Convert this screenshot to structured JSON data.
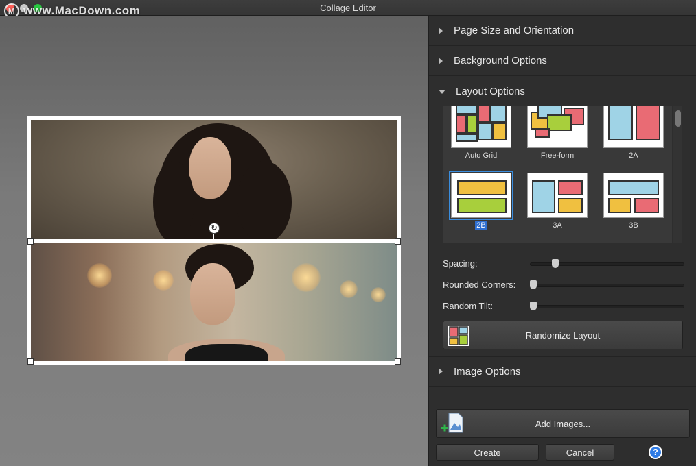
{
  "window": {
    "title": "Collage Editor",
    "watermark": "www.MacDown.com"
  },
  "sections": {
    "page_size": "Page Size and Orientation",
    "background": "Background Options",
    "layout": "Layout Options",
    "image": "Image Options"
  },
  "layouts": [
    {
      "label": "Auto Grid",
      "selected": false
    },
    {
      "label": "Free-form",
      "selected": false
    },
    {
      "label": "2A",
      "selected": false
    },
    {
      "label": "2B",
      "selected": true
    },
    {
      "label": "3A",
      "selected": false
    },
    {
      "label": "3B",
      "selected": false
    }
  ],
  "sliders": {
    "spacing": {
      "label": "Spacing:",
      "value": 0.15
    },
    "rounded": {
      "label": "Rounded Corners:",
      "value": 0.0
    },
    "tilt": {
      "label": "Random Tilt:",
      "value": 0.0
    }
  },
  "buttons": {
    "randomize": "Randomize Layout",
    "add_images": "Add Images...",
    "create": "Create",
    "cancel": "Cancel",
    "help": "?"
  },
  "colors": {
    "accent": "#2e7be6",
    "selection": "#3a8dde"
  }
}
